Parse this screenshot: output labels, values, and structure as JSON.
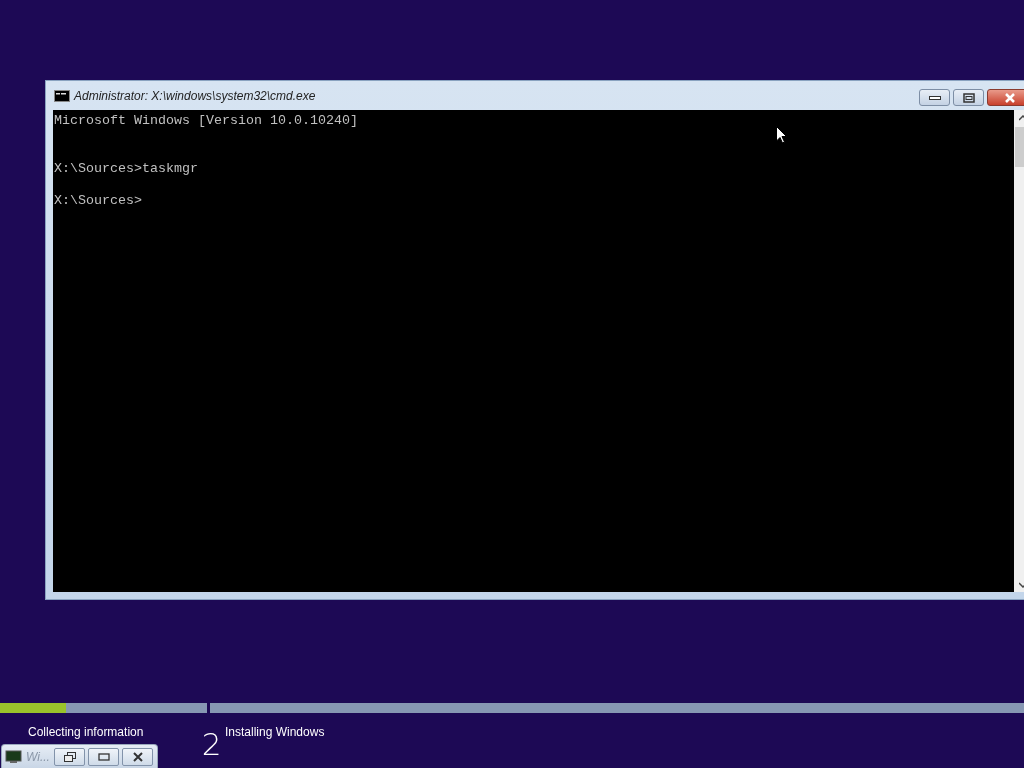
{
  "console_window": {
    "title": "Administrator: X:\\windows\\system32\\cmd.exe",
    "lines": [
      {
        "kind": "banner",
        "text": "Microsoft Windows [Version 10.0.10240]"
      },
      {
        "kind": "prompt",
        "text": "X:\\Sources>taskmgr"
      },
      {
        "kind": "prompt",
        "text": "X:\\Sources>"
      }
    ]
  },
  "setup_steps": [
    {
      "label": "Collecting information",
      "level": 0.32
    },
    {
      "number": "2",
      "label": "Installing Windows",
      "level": 0
    }
  ],
  "minimized_window": {
    "title": "Wi..."
  }
}
